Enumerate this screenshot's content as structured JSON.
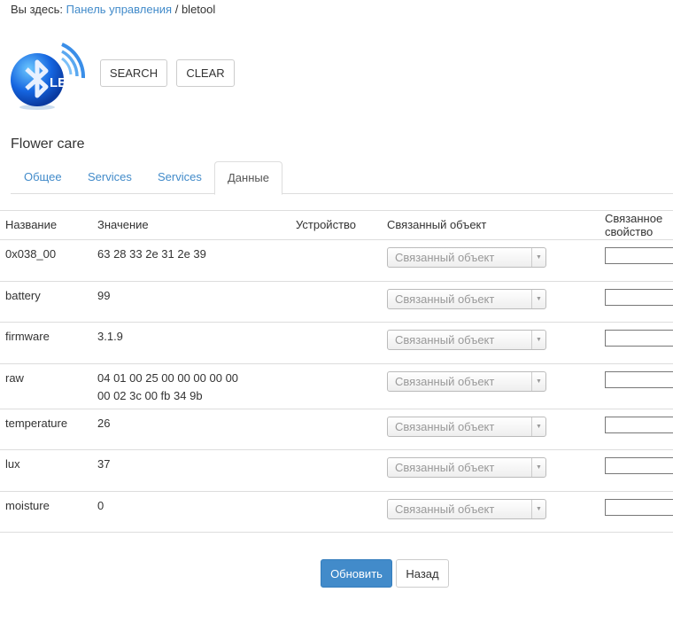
{
  "breadcrumb": {
    "prefix": "Вы здесь:",
    "link": "Панель управления",
    "separator": "/",
    "current": "bletool"
  },
  "logo": {
    "text": "LE"
  },
  "toolbar": {
    "search": "SEARCH",
    "clear": "CLEAR"
  },
  "device_title": "Flower care",
  "tabs": [
    {
      "label": "Общее"
    },
    {
      "label": "Services"
    },
    {
      "label": "Services"
    },
    {
      "label": "Данные",
      "active": true
    }
  ],
  "table": {
    "headers": [
      "Название",
      "Значение",
      "Устройство",
      "Связанный объект",
      "Связанное свойство"
    ],
    "select_placeholder": "Связанный объект",
    "rows": [
      {
        "name": "0x038_00",
        "value": "63 28 33 2e 31 2e 39",
        "device": ""
      },
      {
        "name": "battery",
        "value": "99",
        "device": ""
      },
      {
        "name": "firmware",
        "value": "3.1.9",
        "device": ""
      },
      {
        "name": "raw",
        "value": "04 01 00 25 00 00 00 00 00",
        "value2": "00 02 3c 00 fb 34 9b",
        "device": ""
      },
      {
        "name": "temperature",
        "value": "26",
        "device": ""
      },
      {
        "name": "lux",
        "value": "37",
        "device": ""
      },
      {
        "name": "moisture",
        "value": "0",
        "device": ""
      }
    ]
  },
  "actions": {
    "update": "Обновить",
    "back": "Назад"
  },
  "colors": {
    "accent": "#428bca",
    "link": "#428bca"
  }
}
